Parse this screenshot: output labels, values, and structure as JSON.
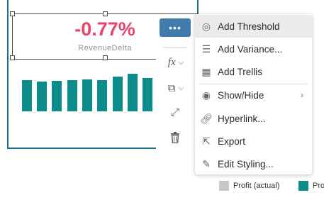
{
  "kpi": {
    "value": "-0.77%",
    "label": "RevenueDelta"
  },
  "toolbar": {
    "more": "•••",
    "fx": "fx"
  },
  "menu": {
    "items": [
      {
        "label": "Add Threshold",
        "icon": "threshold-icon"
      },
      {
        "label": "Add Variance...",
        "icon": "variance-icon"
      },
      {
        "label": "Add Trellis",
        "icon": "trellis-icon"
      },
      {
        "label": "Show/Hide",
        "icon": "eye-icon",
        "submenu": true
      },
      {
        "label": "Hyperlink...",
        "icon": "link-icon"
      },
      {
        "label": "Export",
        "icon": "export-icon"
      },
      {
        "label": "Edit Styling...",
        "icon": "brush-icon"
      }
    ]
  },
  "legend": [
    {
      "label": "Profit (actual)",
      "color": "#c8c8c8"
    },
    {
      "label": "Pro",
      "color": "#0d8c8c"
    }
  ],
  "bar_color": "#0d8c8c"
}
